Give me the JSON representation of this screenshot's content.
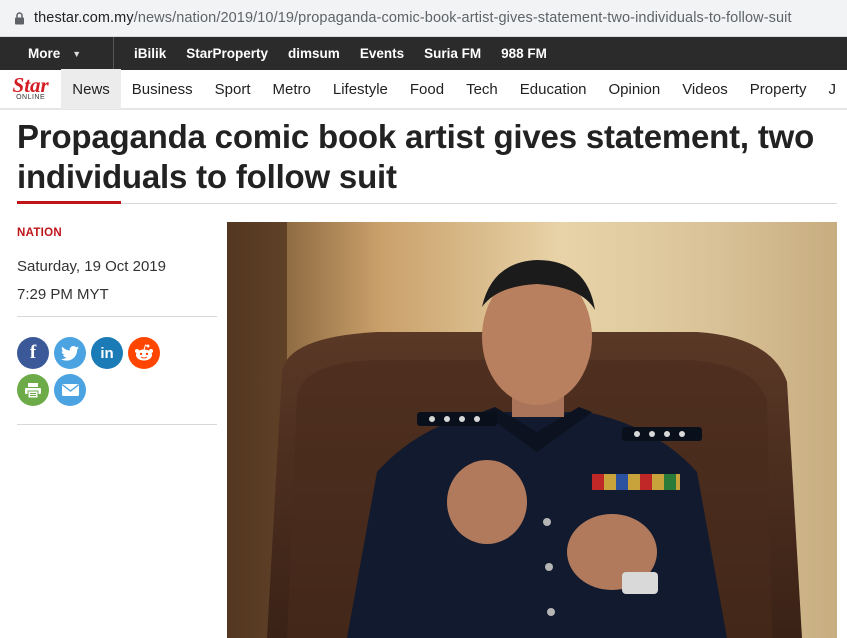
{
  "browser": {
    "url_domain": "thestar.com.my",
    "url_path": "/news/nation/2019/10/19/propaganda-comic-book-artist-gives-statement-two-individuals-to-follow-suit"
  },
  "topbar": {
    "more_label": "More",
    "links": [
      "iBilik",
      "StarProperty",
      "dimsum",
      "Events",
      "Suria FM",
      "988 FM"
    ]
  },
  "logo": {
    "name": "Star",
    "sub": "ONLINE"
  },
  "nav": {
    "items": [
      "News",
      "Business",
      "Sport",
      "Metro",
      "Lifestyle",
      "Food",
      "Tech",
      "Education",
      "Opinion",
      "Videos",
      "Property",
      "J"
    ],
    "active": "News"
  },
  "article": {
    "headline": "Propaganda comic book artist gives statement, two individuals to follow suit",
    "category": "NATION",
    "date": "Saturday, 19 Oct 2019",
    "time": "7:29 PM MYT"
  },
  "share": {
    "icons": [
      "facebook-icon",
      "twitter-icon",
      "linkedin-icon",
      "reddit-icon",
      "print-icon",
      "email-icon"
    ],
    "facebook_glyph": "f",
    "linkedin_glyph": "in"
  },
  "colors": {
    "brand_red": "#c0141b",
    "topbar_bg": "#2b2b2b",
    "facebook": "#3b5998",
    "twitter": "#4ba3e1",
    "linkedin": "#1b7bb6",
    "reddit": "#ff4500",
    "print": "#6dab49",
    "email": "#4ba3e1"
  }
}
